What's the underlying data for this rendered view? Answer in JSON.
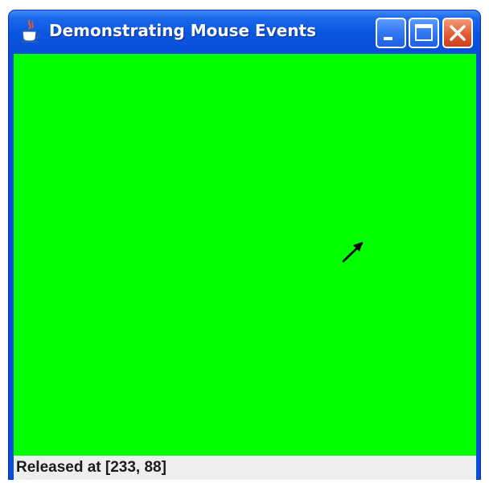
{
  "window": {
    "title": "Demonstrating Mouse Events",
    "app_icon": "java-coffee-cup-icon",
    "controls": {
      "minimize": "minimize-icon",
      "maximize": "maximize-icon",
      "close": "close-icon"
    }
  },
  "canvas": {
    "background_color": "#00ff00",
    "cursor_icon": "arrow-cursor-icon"
  },
  "status": {
    "text": "Released at [233, 88]"
  },
  "colors": {
    "titlebar": "#0a4fd8",
    "close_button": "#e25b35",
    "status_background": "#eeeeee"
  }
}
